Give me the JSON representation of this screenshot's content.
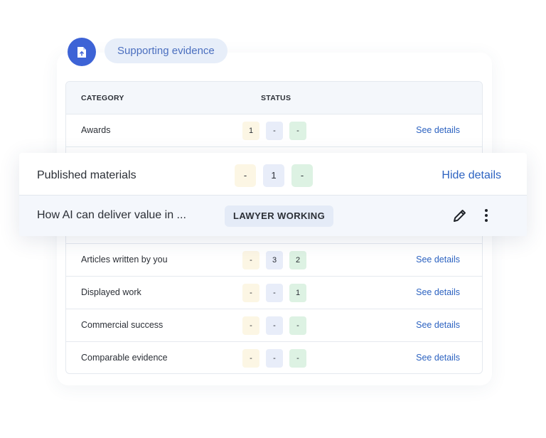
{
  "header": {
    "icon": "upload-document-icon",
    "pill_label": "Supporting evidence"
  },
  "table": {
    "columns": {
      "category": "CATEGORY",
      "status": "STATUS"
    },
    "rows": [
      {
        "category": "Awards",
        "s1": "1",
        "s2": "-",
        "s3": "-",
        "link": "See details"
      },
      {
        "category": "Articles written by you",
        "s1": "-",
        "s2": "3",
        "s3": "2",
        "link": "See details"
      },
      {
        "category": "Displayed work",
        "s1": "-",
        "s2": "-",
        "s3": "1",
        "link": "See details"
      },
      {
        "category": "Commercial success",
        "s1": "-",
        "s2": "-",
        "s3": "-",
        "link": "See details"
      },
      {
        "category": "Comparable evidence",
        "s1": "-",
        "s2": "-",
        "s3": "-",
        "link": "See details"
      }
    ]
  },
  "expanded": {
    "category": "Published materials",
    "s1": "-",
    "s2": "1",
    "s3": "-",
    "link": "Hide details",
    "item": {
      "title": "How AI can deliver value in ...",
      "badge": "LAWYER WORKING",
      "edit_icon": "pencil-icon",
      "more_icon": "more-vertical-icon"
    }
  },
  "colors": {
    "accent": "#3d63d6",
    "link": "#2d63c1",
    "chip_yellow": "#fcf6e4",
    "chip_blue": "#e8edf9",
    "chip_green": "#ddf2e3"
  }
}
